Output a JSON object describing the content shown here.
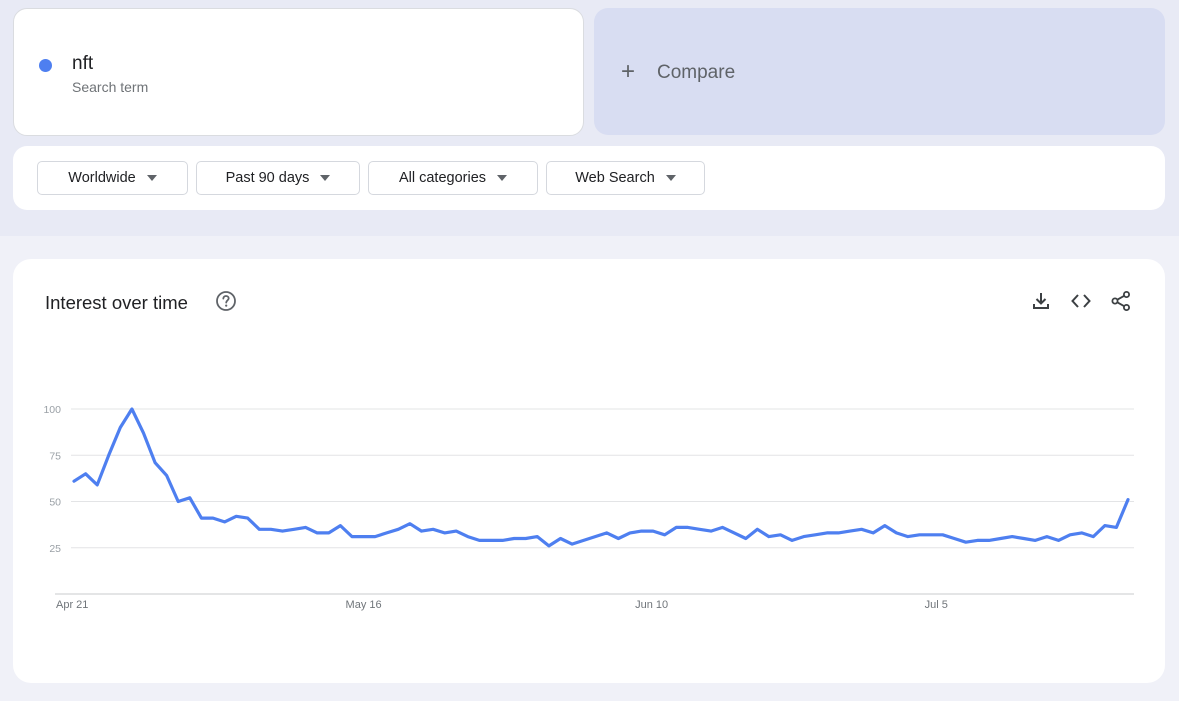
{
  "search_term": {
    "name": "nft",
    "subtitle": "Search term",
    "color": "#4e7ff0"
  },
  "compare": {
    "label": "Compare"
  },
  "filters": [
    {
      "label": "Worldwide"
    },
    {
      "label": "Past 90 days"
    },
    {
      "label": "All categories"
    },
    {
      "label": "Web Search"
    }
  ],
  "chart_panel": {
    "title": "Interest over time",
    "icons": [
      "help-icon",
      "download-icon",
      "embed-code-icon",
      "share-icon"
    ]
  },
  "chart_data": {
    "type": "line",
    "title": "",
    "xlabel": "",
    "ylabel": "",
    "ylim": [
      0,
      100
    ],
    "y_ticks": [
      "100",
      "75",
      "50",
      "25"
    ],
    "x_tick_labels": [
      {
        "label": "Apr 21",
        "index": 0
      },
      {
        "label": "May 16",
        "index": 25
      },
      {
        "label": "Jun 10",
        "index": 50
      },
      {
        "label": "Jul 5",
        "index": 75
      }
    ],
    "grid": true,
    "series": [
      {
        "color": "#4e7ff0",
        "values": [
          61,
          65,
          59,
          75,
          90,
          100,
          87,
          71,
          64,
          50,
          52,
          41,
          41,
          39,
          42,
          41,
          35,
          35,
          34,
          35,
          36,
          33,
          33,
          37,
          31,
          31,
          31,
          33,
          35,
          38,
          34,
          35,
          33,
          34,
          31,
          29,
          29,
          29,
          30,
          30,
          31,
          26,
          30,
          27,
          29,
          31,
          33,
          30,
          33,
          34,
          34,
          32,
          36,
          36,
          35,
          34,
          36,
          33,
          30,
          35,
          31,
          32,
          29,
          31,
          32,
          33,
          33,
          34,
          35,
          33,
          37,
          33,
          31,
          32,
          32,
          32,
          30,
          28,
          29,
          29,
          30,
          31,
          30,
          29,
          31,
          29,
          32,
          33,
          31,
          37,
          36,
          51
        ]
      }
    ]
  }
}
